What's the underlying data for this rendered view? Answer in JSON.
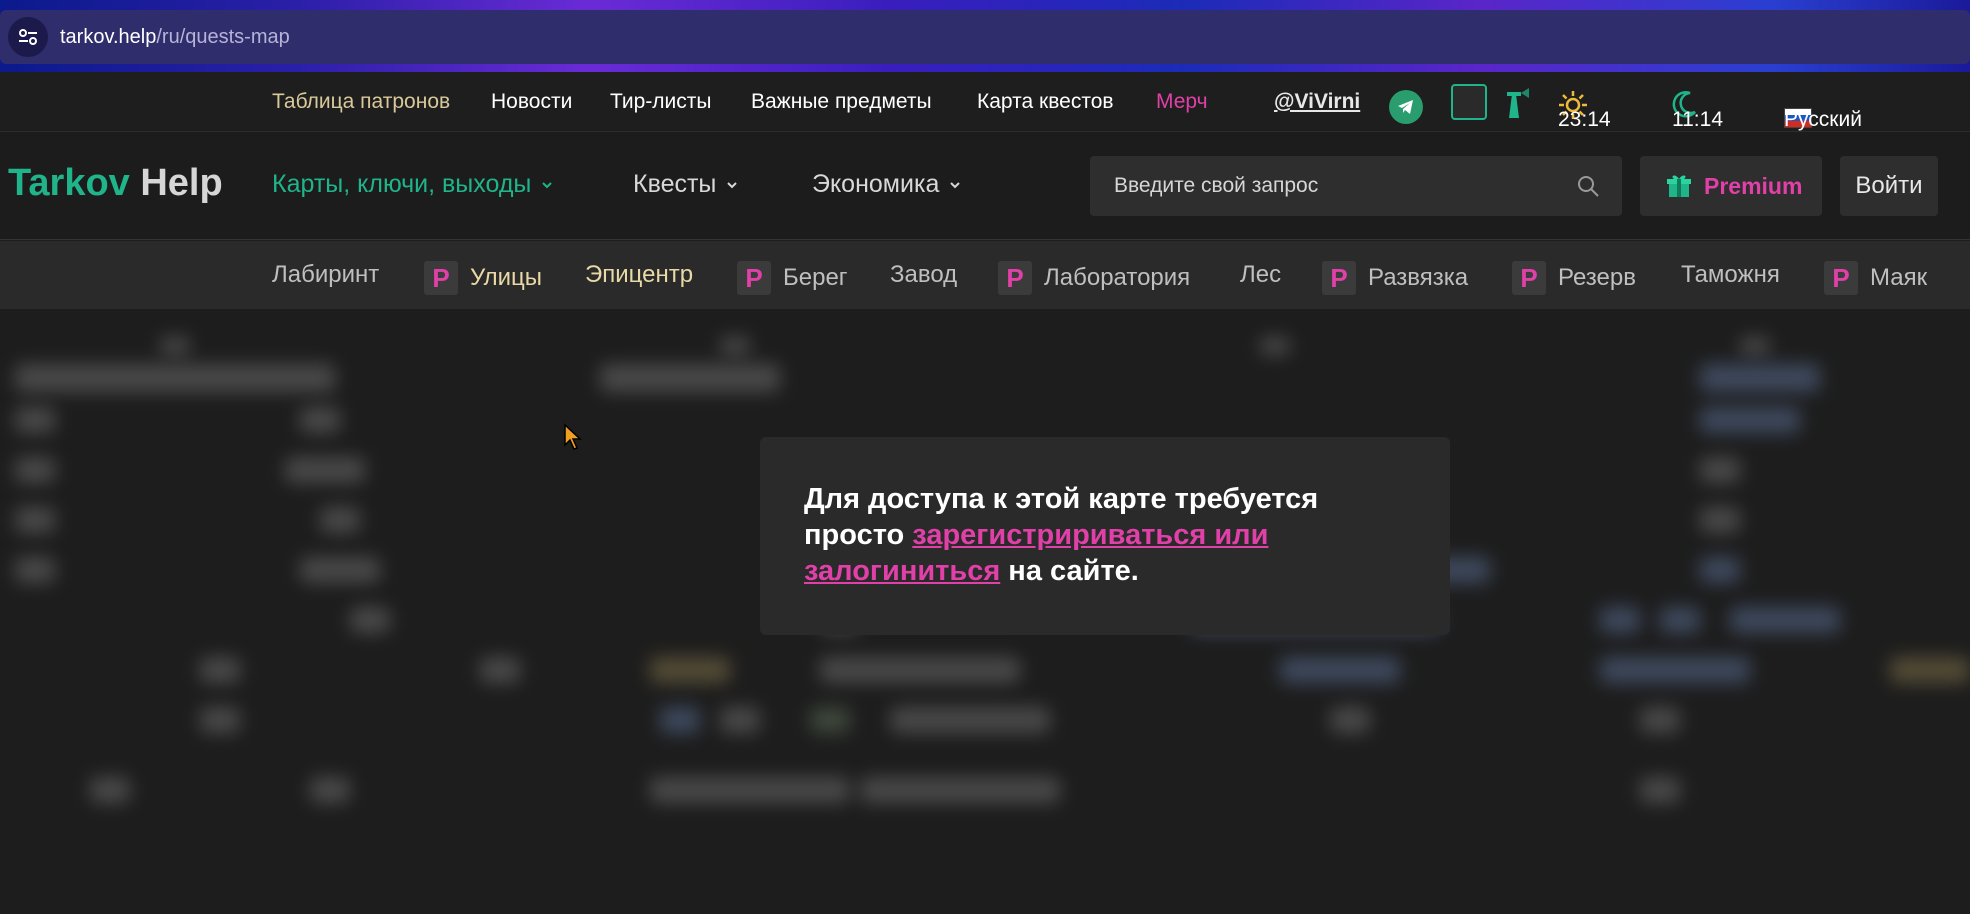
{
  "browser": {
    "url_host": "tarkov.help",
    "url_path": "/ru/quests-map"
  },
  "topnav": {
    "ammo_table": "Таблица патронов",
    "news": "Новости",
    "tier_lists": "Тир-листы",
    "important_items": "Важные предметы",
    "quest_map": "Карта квестов",
    "merch": "Мерч",
    "author": "@ViVirni",
    "time_day": "23:14",
    "time_night": "11:14",
    "language": "Русский"
  },
  "header": {
    "logo_part1": "Tarkov",
    "logo_part2": "Help",
    "menu_maps": "Карты, ключи, выходы",
    "menu_quests": "Квесты",
    "menu_economy": "Экономика",
    "search_placeholder": "Введите свой запрос",
    "premium_label": "Premium",
    "login_label": "Войти"
  },
  "maptabs": [
    {
      "label": "Лабиринт",
      "premium": false
    },
    {
      "label": "Улицы",
      "premium": true
    },
    {
      "label": "Эпицентр",
      "premium": false
    },
    {
      "label": "Берег",
      "premium": true
    },
    {
      "label": "Завод",
      "premium": false
    },
    {
      "label": "Лаборатория",
      "premium": true
    },
    {
      "label": "Лес",
      "premium": false
    },
    {
      "label": "Развязка",
      "premium": true
    },
    {
      "label": "Резерв",
      "premium": true
    },
    {
      "label": "Таможня",
      "premium": false
    },
    {
      "label": "Маяк",
      "premium": true
    }
  ],
  "premium_badge": "P",
  "modal": {
    "text_before": "Для доступа к этой карте требуется просто ",
    "link_text": "зарегистририваться или залогиниться",
    "text_after": " на сайте."
  },
  "colors": {
    "accent_green": "#1fb489",
    "accent_pink": "#e040a8",
    "background": "#1d1d1d"
  }
}
